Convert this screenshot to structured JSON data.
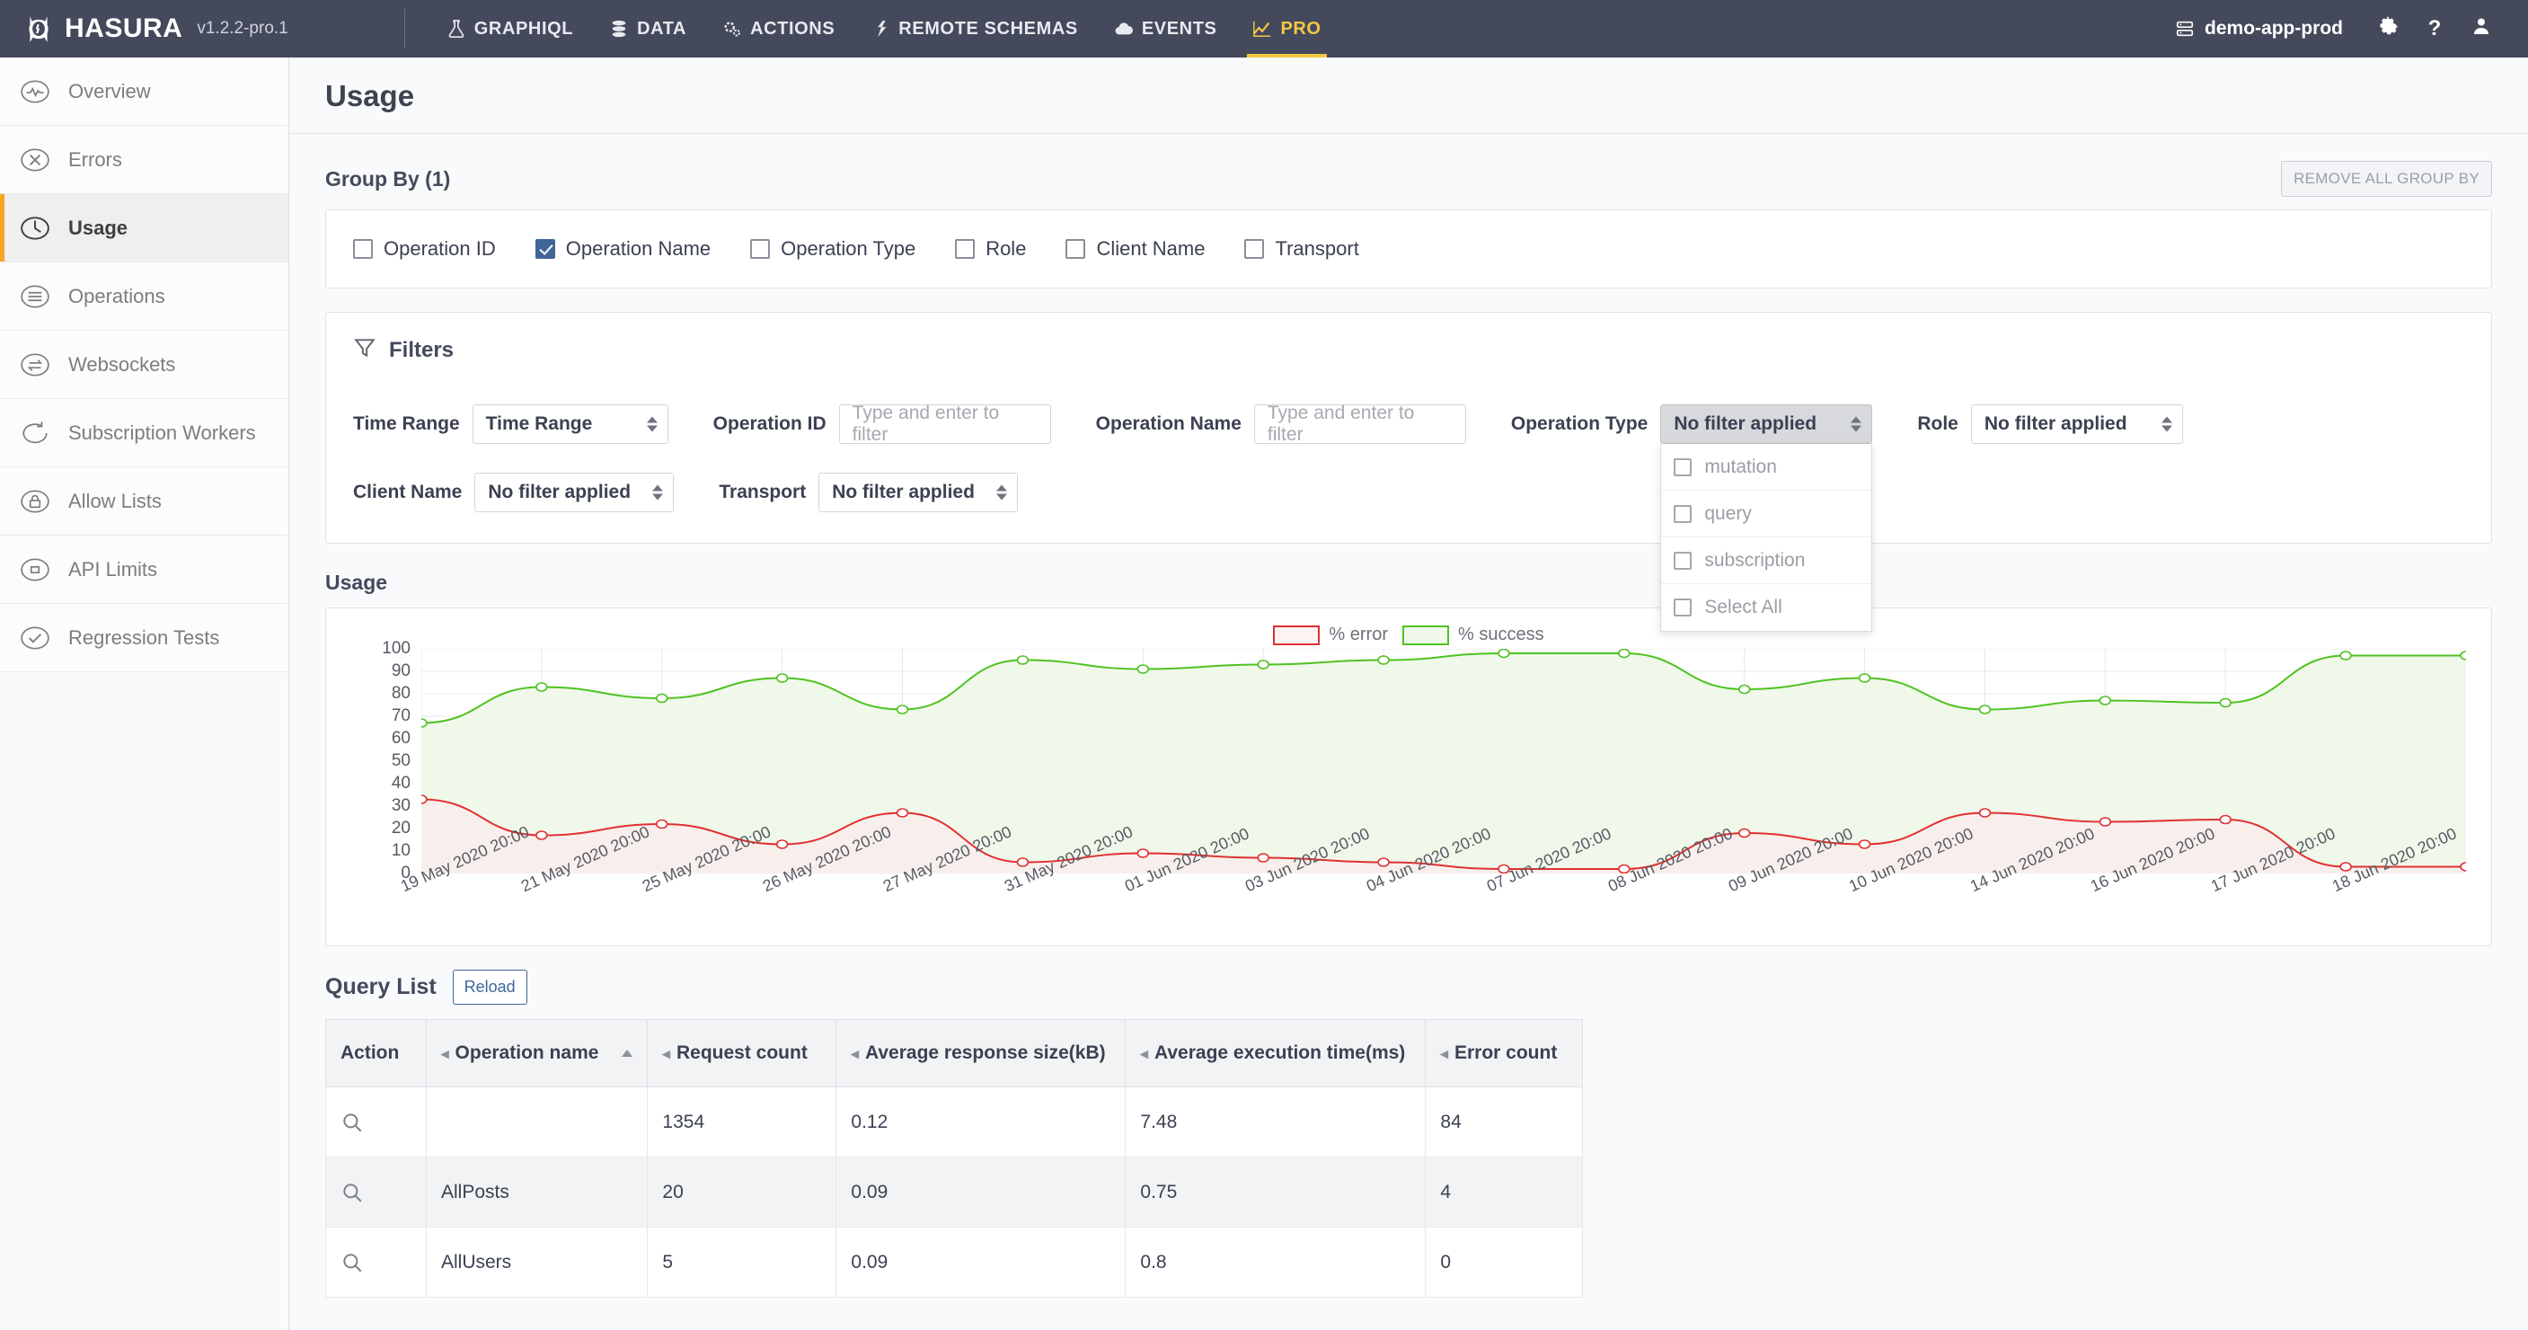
{
  "topbar": {
    "brand": "HASURA",
    "version": "v1.2.2-pro.1",
    "nav": [
      {
        "label": "GRAPHIQL",
        "icon": "flask-icon",
        "active": false
      },
      {
        "label": "DATA",
        "icon": "database-icon",
        "active": false
      },
      {
        "label": "ACTIONS",
        "icon": "gears-icon",
        "active": false
      },
      {
        "label": "REMOTE SCHEMAS",
        "icon": "plug-icon",
        "active": false
      },
      {
        "label": "EVENTS",
        "icon": "cloud-icon",
        "active": false
      },
      {
        "label": "PRO",
        "icon": "chart-line-icon",
        "active": true
      }
    ],
    "project": "demo-app-prod",
    "project_icon": "server-icon",
    "settings_icon": "gear-icon",
    "help_icon": "question-icon",
    "help_label": "?",
    "user_icon": "user-icon",
    "active_color": "#f5c842"
  },
  "sidebar": {
    "items": [
      {
        "label": "Overview",
        "icon": "pulse-circle-icon",
        "active": false
      },
      {
        "label": "Errors",
        "icon": "x-circle-icon",
        "active": false
      },
      {
        "label": "Usage",
        "icon": "clock-circle-icon",
        "active": true
      },
      {
        "label": "Operations",
        "icon": "list-circle-icon",
        "active": false
      },
      {
        "label": "Websockets",
        "icon": "exchange-circle-icon",
        "active": false
      },
      {
        "label": "Subscription Workers",
        "icon": "refresh-circle-icon",
        "active": false
      },
      {
        "label": "Allow Lists",
        "icon": "lock-circle-icon",
        "active": false
      },
      {
        "label": "API Limits",
        "icon": "square-circle-icon",
        "active": false
      },
      {
        "label": "Regression Tests",
        "icon": "check-circle-icon",
        "active": false
      }
    ],
    "active_accent": "#f5a623"
  },
  "page": {
    "title": "Usage"
  },
  "group_by": {
    "title": "Group By (1)",
    "remove_all_label": "REMOVE ALL GROUP BY",
    "options": [
      {
        "label": "Operation ID",
        "checked": false
      },
      {
        "label": "Operation Name",
        "checked": true
      },
      {
        "label": "Operation Type",
        "checked": false
      },
      {
        "label": "Role",
        "checked": false
      },
      {
        "label": "Client Name",
        "checked": false
      },
      {
        "label": "Transport",
        "checked": false
      }
    ],
    "checked_color": "#3f6599"
  },
  "filters": {
    "title": "Filters",
    "icon": "funnel-icon",
    "row1": [
      {
        "label": "Time Range",
        "type": "select",
        "value": "Time Range",
        "width": 160
      },
      {
        "label": "Operation ID",
        "type": "input",
        "value": "",
        "placeholder": "Type and enter to filter",
        "width": 198
      },
      {
        "label": "Operation Name",
        "type": "input",
        "value": "",
        "placeholder": "Type and enter to filter",
        "width": 198
      },
      {
        "label": "Operation Type",
        "type": "select",
        "value": "No filter applied",
        "width": 178,
        "open": true
      },
      {
        "label": "Role",
        "type": "select",
        "value": "No filter applied",
        "width": 178
      }
    ],
    "row2": [
      {
        "label": "Client Name",
        "type": "select",
        "value": "No filter applied",
        "width": 178
      },
      {
        "label": "Transport",
        "type": "select",
        "value": "No filter applied",
        "width": 178
      }
    ],
    "operation_type_dropdown": {
      "open": true,
      "items": [
        {
          "label": "mutation",
          "checked": false
        },
        {
          "label": "query",
          "checked": false
        },
        {
          "label": "subscription",
          "checked": false
        },
        {
          "label": "Select All",
          "checked": false
        }
      ]
    }
  },
  "usage_chart": {
    "title": "Usage"
  },
  "chart_data": {
    "type": "area",
    "title": "Usage",
    "xlabel": "",
    "ylabel": "",
    "ylim": [
      0,
      100
    ],
    "yticks": [
      0,
      10,
      20,
      30,
      40,
      50,
      60,
      70,
      80,
      90,
      100
    ],
    "grid": true,
    "legend_position": "top-center",
    "legend": [
      "% error",
      "% success"
    ],
    "colors": {
      "error": "#e03131",
      "success": "#4fc222"
    },
    "x": [
      "19 May 2020 20:00",
      "21 May 2020 20:00",
      "25 May 2020 20:00",
      "26 May 2020 20:00",
      "27 May 2020 20:00",
      "31 May 2020 20:00",
      "01 Jun 2020 20:00",
      "03 Jun 2020 20:00",
      "04 Jun 2020 20:00",
      "07 Jun 2020 20:00",
      "08 Jun 2020 20:00",
      "09 Jun 2020 20:00",
      "10 Jun 2020 20:00",
      "14 Jun 2020 20:00",
      "16 Jun 2020 20:00",
      "17 Jun 2020 20:00",
      "18 Jun 2020 20:00"
    ],
    "series": [
      {
        "name": "% success",
        "color": "#4fc222",
        "values": [
          67,
          83,
          78,
          87,
          73,
          95,
          91,
          93,
          95,
          98,
          98,
          82,
          87,
          73,
          77,
          76,
          97,
          97
        ]
      },
      {
        "name": "% error",
        "color": "#e03131",
        "values": [
          33,
          17,
          22,
          13,
          27,
          5,
          9,
          7,
          5,
          2,
          2,
          18,
          13,
          27,
          23,
          24,
          3,
          3
        ]
      }
    ]
  },
  "query_list": {
    "title": "Query List",
    "reload_label": "Reload",
    "columns": [
      {
        "label": "Action",
        "sortable": false
      },
      {
        "label": "Operation name",
        "sortable": true,
        "sorted": "asc"
      },
      {
        "label": "Request count",
        "sortable": true
      },
      {
        "label": "Average response size(kB)",
        "sortable": true
      },
      {
        "label": "Average execution time(ms)",
        "sortable": true
      },
      {
        "label": "Error count",
        "sortable": true
      }
    ],
    "rows": [
      {
        "operation_name": "",
        "request_count": "1354",
        "avg_response_size": "0.12",
        "avg_execution_time": "7.48",
        "error_count": "84"
      },
      {
        "operation_name": "AllPosts",
        "request_count": "20",
        "avg_response_size": "0.09",
        "avg_execution_time": "0.75",
        "error_count": "4"
      },
      {
        "operation_name": "AllUsers",
        "request_count": "5",
        "avg_response_size": "0.09",
        "avg_execution_time": "0.8",
        "error_count": "0"
      }
    ]
  }
}
